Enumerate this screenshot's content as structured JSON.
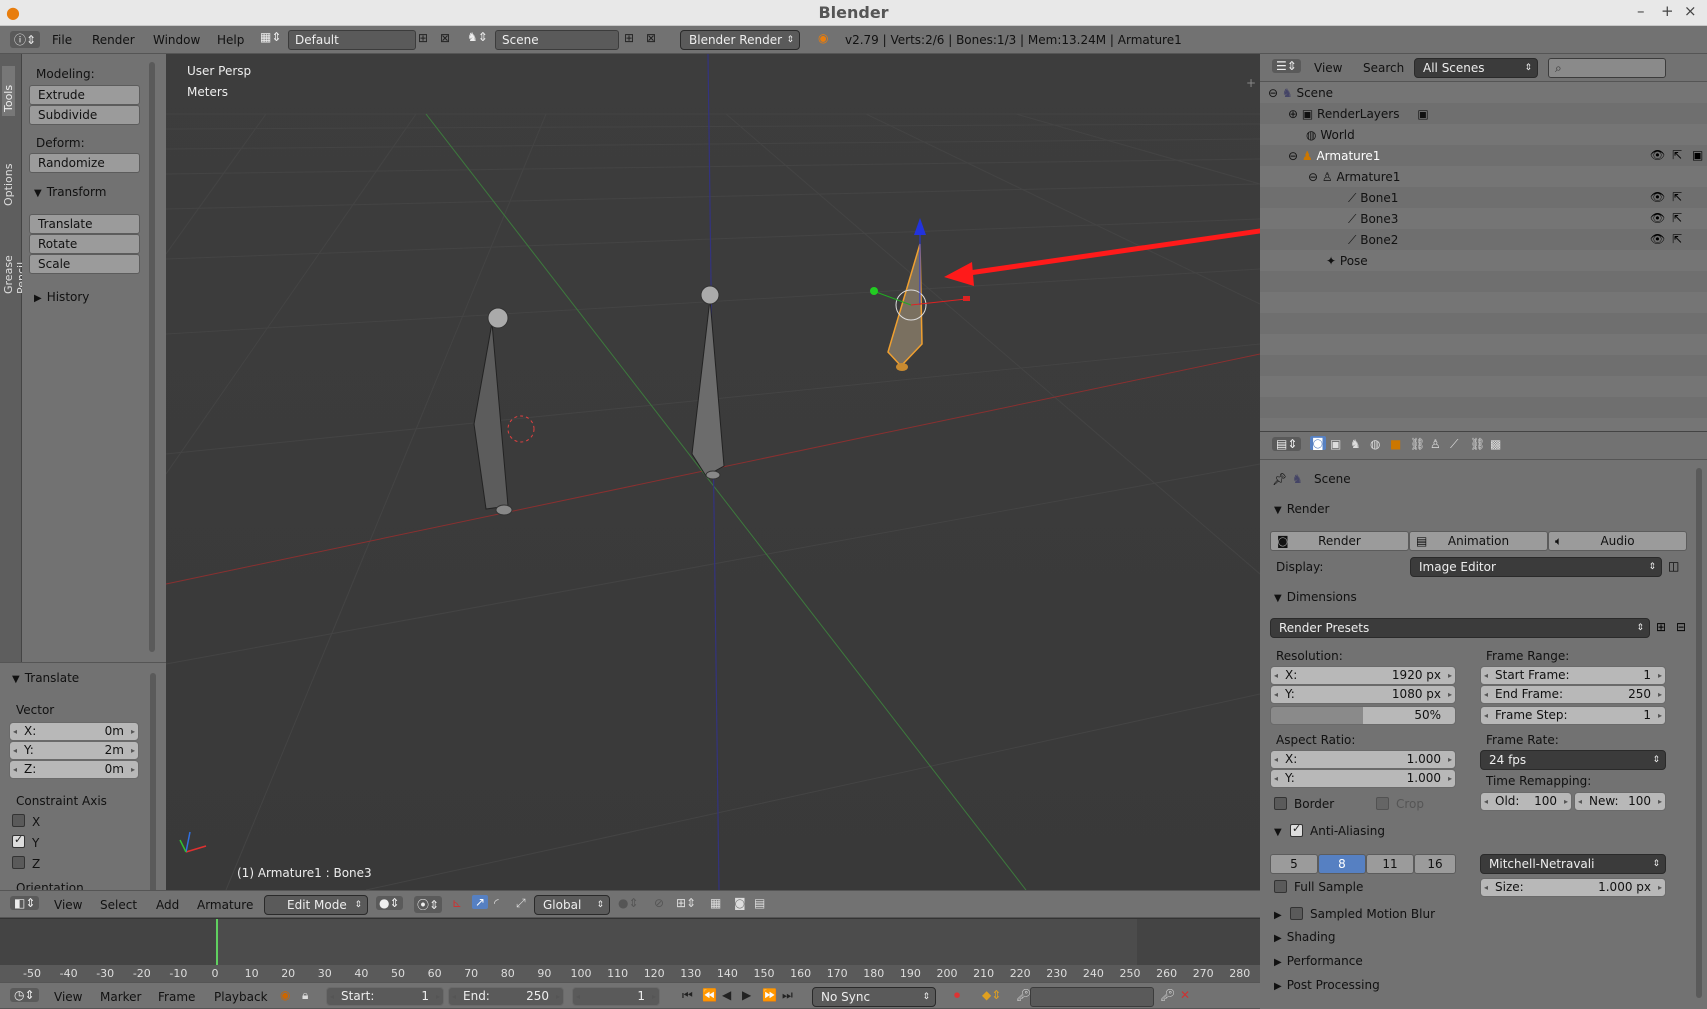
{
  "window": {
    "title": "Blender",
    "controls": [
      "–",
      "+",
      "×"
    ]
  },
  "info_header": {
    "menus": [
      "File",
      "Render",
      "Window",
      "Help"
    ],
    "layout": "Default",
    "scene": "Scene",
    "engine": "Blender Render",
    "stats": "v2.79 | Verts:2/6 | Bones:1/3 | Mem:13.24M | Armature1"
  },
  "toolshelf": {
    "tabs": [
      "Tools",
      "Options",
      "Grease Pencil"
    ],
    "modeling_label": "Modeling:",
    "extrude": "Extrude",
    "subdivide": "Subdivide",
    "deform_label": "Deform:",
    "randomize": "Randomize",
    "transform_header": "Transform",
    "translate": "Translate",
    "rotate": "Rotate",
    "scale": "Scale",
    "history_header": "History"
  },
  "operator_panel": {
    "header": "Translate",
    "vector_label": "Vector",
    "x_label": "X:",
    "x_value": "0m",
    "y_label": "Y:",
    "y_value": "2m",
    "z_label": "Z:",
    "z_value": "0m",
    "constraint_label": "Constraint Axis",
    "axes": [
      {
        "label": "X",
        "checked": false
      },
      {
        "label": "Y",
        "checked": true
      },
      {
        "label": "Z",
        "checked": false
      }
    ],
    "orientation_label": "Orientation"
  },
  "viewport": {
    "view_name": "User Persp",
    "units": "Meters",
    "status": "(1) Armature1 : Bone3"
  },
  "viewport_header": {
    "menus": [
      "View",
      "Select",
      "Add",
      "Armature"
    ],
    "mode": "Edit Mode",
    "orientation": "Global"
  },
  "timeline": {
    "ticks": [
      "-50",
      "-40",
      "-30",
      "-20",
      "-10",
      "0",
      "10",
      "20",
      "30",
      "40",
      "50",
      "60",
      "70",
      "80",
      "90",
      "100",
      "110",
      "120",
      "130",
      "140",
      "150",
      "160",
      "170",
      "180",
      "190",
      "200",
      "210",
      "220",
      "230",
      "240",
      "250",
      "260",
      "270",
      "280"
    ],
    "menus": [
      "View",
      "Marker",
      "Frame",
      "Playback"
    ],
    "start_label": "Start:",
    "start_value": "1",
    "end_label": "End:",
    "end_value": "250",
    "current_frame": "1",
    "sync": "No Sync"
  },
  "outliner": {
    "menus": [
      "View",
      "Search"
    ],
    "filter": "All Scenes",
    "items": [
      {
        "label": "Scene",
        "indent": 0
      },
      {
        "label": "RenderLayers",
        "indent": 1
      },
      {
        "label": "World",
        "indent": 1
      },
      {
        "label": "Armature1",
        "indent": 1
      },
      {
        "label": "Armature1",
        "indent": 2
      },
      {
        "label": "Bone1",
        "indent": 3
      },
      {
        "label": "Bone3",
        "indent": 3
      },
      {
        "label": "Bone2",
        "indent": 3
      },
      {
        "label": "Pose",
        "indent": 2
      }
    ]
  },
  "properties": {
    "context": "Scene",
    "render_header": "Render",
    "render_btn": "Render",
    "animation_btn": "Animation",
    "audio_btn": "Audio",
    "display_label": "Display:",
    "display_value": "Image Editor",
    "dimensions_header": "Dimensions",
    "render_presets": "Render Presets",
    "resolution_label": "Resolution:",
    "res_x_label": "X:",
    "res_x": "1920 px",
    "res_y_label": "Y:",
    "res_y": "1080 px",
    "res_pct": "50%",
    "frame_range_label": "Frame Range:",
    "start_frame_label": "Start Frame:",
    "start_frame": "1",
    "end_frame_label": "End Frame:",
    "end_frame": "250",
    "frame_step_label": "Frame Step:",
    "frame_step": "1",
    "aspect_label": "Aspect Ratio:",
    "asp_x_label": "X:",
    "asp_x": "1.000",
    "asp_y_label": "Y:",
    "asp_y": "1.000",
    "frame_rate_label": "Frame Rate:",
    "frame_rate": "24 fps",
    "time_remap_label": "Time Remapping:",
    "old_label": "Old:",
    "old_value": "100",
    "new_label": "New:",
    "new_value": "100",
    "border_label": "Border",
    "crop_label": "Crop",
    "aa_header": "Anti-Aliasing",
    "aa_samples": [
      "5",
      "8",
      "11",
      "16"
    ],
    "aa_selected": "8",
    "aa_filter": "Mitchell-Netravali",
    "full_sample": "Full Sample",
    "size_label": "Size:",
    "size_value": "1.000 px",
    "motion_blur": "Sampled Motion Blur",
    "shading": "Shading",
    "performance": "Performance",
    "post_processing": "Post Processing"
  },
  "colors": {
    "accent": "#5680c2",
    "selected_bone": "#f0a030",
    "arrow": "#ff1a1a"
  }
}
